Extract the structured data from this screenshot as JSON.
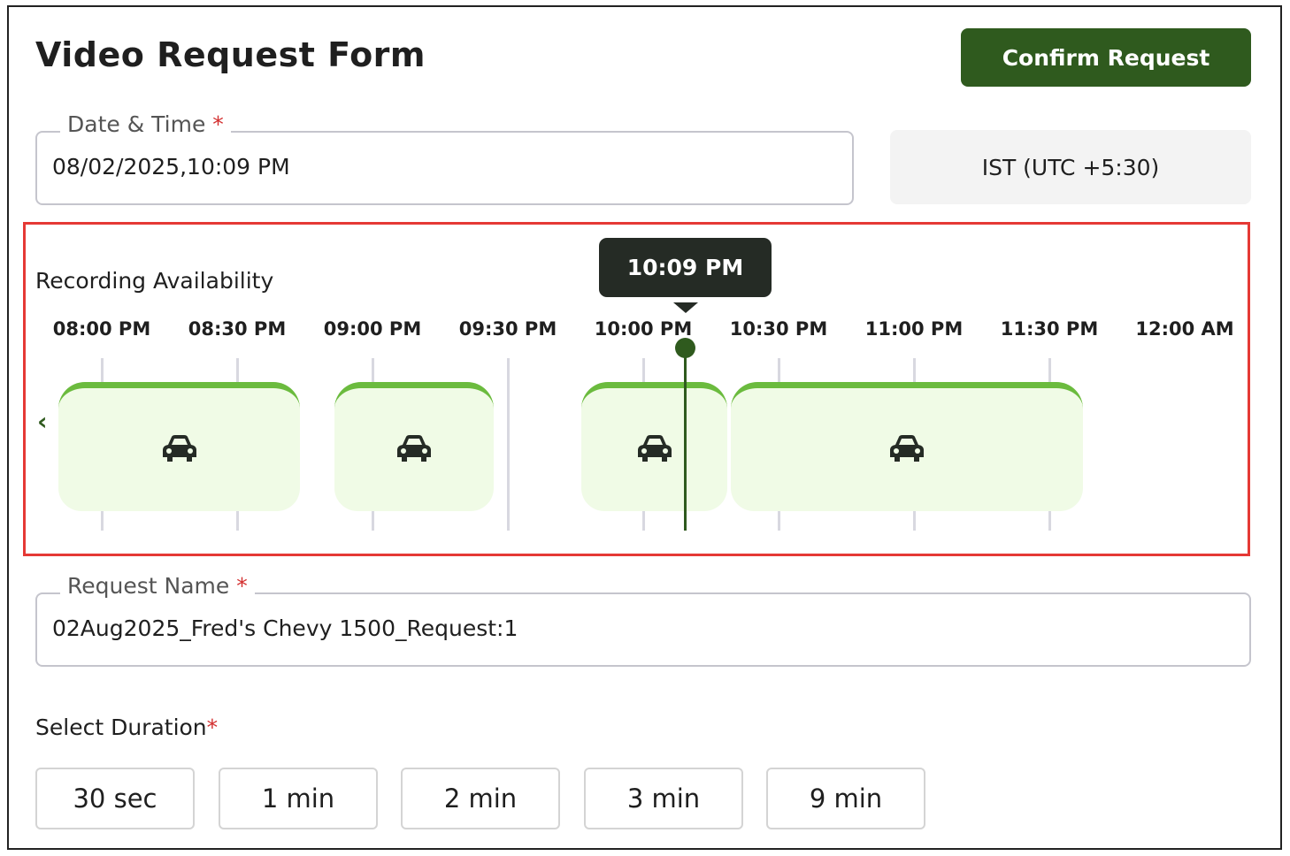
{
  "header": {
    "title": "Video Request Form",
    "confirm_label": "Confirm Request"
  },
  "datetime": {
    "label": "Date & Time",
    "required": "*",
    "value": "08/02/2025,10:09 PM",
    "timezone": "IST (UTC +5:30)"
  },
  "timeline": {
    "title": "Recording Availability",
    "current_time": "10:09 PM",
    "ticks": [
      "08:00 PM",
      "08:30 PM",
      "09:00 PM",
      "09:30 PM",
      "10:00 PM",
      "10:30 PM",
      "11:00 PM",
      "11:30 PM",
      "12:00 AM"
    ],
    "prev_icon": "chevron-left-icon",
    "block_icon": "car-icon",
    "accent": "#6bbb3e",
    "block_fill": "#f0fbe6"
  },
  "request_name": {
    "label": "Request Name",
    "required": "*",
    "value": "02Aug2025_Fred's Chevy 1500_Request:1"
  },
  "duration": {
    "label": "Select Duration",
    "required": "*",
    "options": [
      "30 sec",
      "1 min",
      "2 min",
      "3 min",
      "9 min"
    ]
  },
  "colors": {
    "primary": "#2f5a1e",
    "highlight": "#e53935"
  }
}
